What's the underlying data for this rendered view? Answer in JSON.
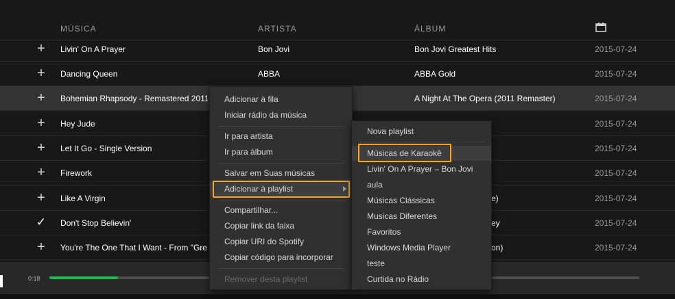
{
  "columns": {
    "song": "MÚSICA",
    "artist": "ARTISTA",
    "album": "ÁLBUM",
    "date_icon": "calendar-icon"
  },
  "tracks": [
    {
      "status": "+",
      "song": "Livin' On A Prayer",
      "artist": "Bon Jovi",
      "album": "Bon Jovi Greatest Hits",
      "date": "2015-07-24"
    },
    {
      "status": "+",
      "song": "Dancing Queen",
      "artist": "ABBA",
      "album": "ABBA Gold",
      "date": "2015-07-24"
    },
    {
      "status": "+",
      "song": "Bohemian Rhapsody - Remastered 2011",
      "artist": "",
      "album": "A Night At The Opera (2011 Remaster)",
      "date": "2015-07-24"
    },
    {
      "status": "+",
      "song": "Hey Jude",
      "artist": "",
      "album": "",
      "date": "2015-07-24"
    },
    {
      "status": "+",
      "song": "Let It Go - Single Version",
      "artist": "",
      "album": "",
      "date": "2015-07-24"
    },
    {
      "status": "+",
      "song": "Firework",
      "artist": "",
      "album": "",
      "date": "2015-07-24"
    },
    {
      "status": "+",
      "song": "Like A Virgin",
      "artist": "",
      "album": "e)",
      "date": "2015-07-24"
    },
    {
      "status": "✓",
      "song": "Don't Stop Believin'",
      "artist": "",
      "album": "ey",
      "date": "2015-07-24"
    },
    {
      "status": "+",
      "song": "You're The One That I Want - From \"Gre",
      "artist": "",
      "album": "on)",
      "date": "2015-07-24"
    }
  ],
  "context_menu": {
    "items": [
      "Adicionar à fila",
      "Iniciar rádio da música",
      "Ir para artista",
      "Ir para álbum",
      "Salvar em Suas músicas",
      "Adicionar à playlist",
      "Compartilhar...",
      "Copiar link da faixa",
      "Copiar URI do Spotify",
      "Copiar código para incorporar",
      "Remover desta playlist"
    ]
  },
  "playlist_submenu": {
    "items": [
      "Nova playlist",
      "Músicas de Karaokê",
      "Livin' On A Prayer – Bon Jovi",
      "aula",
      "Músicas Clássicas",
      "Musicas Diferentes",
      "Favoritos",
      "Windows Media Player",
      "teste",
      "Curtida no Rádio"
    ]
  },
  "player": {
    "elapsed": "0:18",
    "progress_fraction": 0.116
  },
  "colors": {
    "highlight": "#f5a623",
    "progress": "#1db954",
    "background": "#181818"
  }
}
